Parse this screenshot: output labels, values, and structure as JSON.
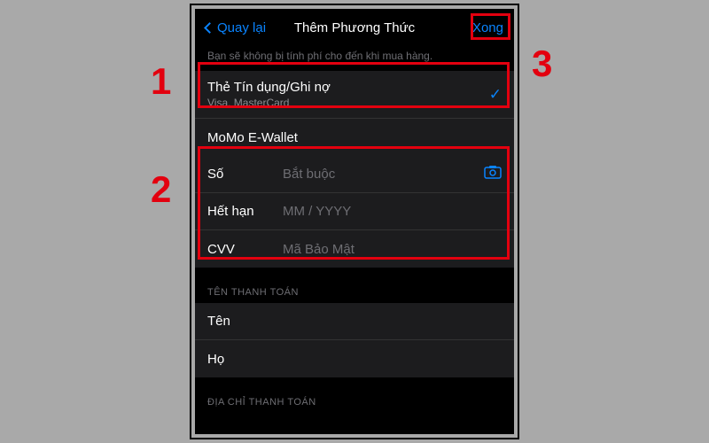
{
  "nav": {
    "back": "Quay lại",
    "title": "Thêm Phương Thức",
    "done": "Xong"
  },
  "subtitle": "Bạn sẽ không bị tính phí cho đến khi mua hàng.",
  "methods": [
    {
      "title": "Thẻ Tín dụng/Ghi nợ",
      "subtitle": "Visa, MasterCard",
      "selected": true
    },
    {
      "title": "MoMo E-Wallet",
      "subtitle": "",
      "selected": false
    }
  ],
  "card_form": {
    "number": {
      "label": "Số",
      "placeholder": "Bắt buộc"
    },
    "expiry": {
      "label": "Hết hạn",
      "placeholder": "MM / YYYY"
    },
    "cvv": {
      "label": "CVV",
      "placeholder": "Mã Bảo Mật"
    }
  },
  "name_section": {
    "header": "TÊN THANH TOÁN",
    "first": "Tên",
    "last": "Họ"
  },
  "address_section": {
    "header": "ĐỊA CHỈ THANH TOÁN"
  },
  "annotations": {
    "a1": "1",
    "a2": "2",
    "a3": "3"
  }
}
